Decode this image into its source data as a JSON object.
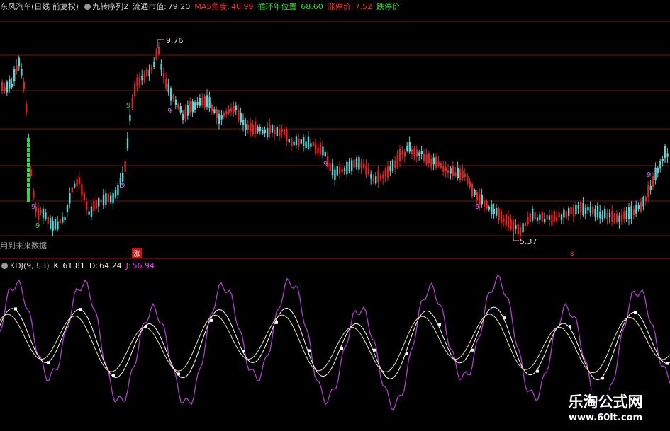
{
  "header": {
    "stock_title": "东风汽车(日线 前复权)",
    "indicator_name": "九转序列2",
    "float_cap_label": "流通市值:",
    "float_cap_value": "79.20",
    "ma5_angle_label": "MA5角度:",
    "ma5_angle_value": "40.99",
    "cycle_pos_label": "循环年位置:",
    "cycle_pos_value": "68.60",
    "limit_up_label": "涨停价:",
    "limit_up_value": "7.52",
    "limit_down_label": "跌停价"
  },
  "price_pane": {
    "high_label": "9.76",
    "low_label": "5.37",
    "future_data_note": "用到未来数据",
    "rise_marker": "涨"
  },
  "kdj_pane": {
    "name": "KDJ(9,3,3)",
    "k_label": "K:",
    "k_value": "61.81",
    "d_label": "D:",
    "d_value": "64.24",
    "j_label": "J:",
    "j_value": "56.94"
  },
  "watermark": {
    "site_name": "乐淘公式网",
    "url": "www.60lt.com"
  },
  "colors": {
    "background": "#000000",
    "up": "#e02424",
    "down": "#5fd3d3",
    "grid": "#7a1212",
    "nine_green": "#33dd33",
    "nine_magenta": "#cc66ff",
    "k_line": "#ffffff",
    "d_line": "#e8e8a0",
    "j_line": "#b040c8",
    "label_gray": "#d0d0d0",
    "label_red": "#ff3030",
    "label_green": "#33dd33",
    "label_magenta": "#ff33ff"
  },
  "chart_data": {
    "type": "candlestick",
    "price_range": [
      5.0,
      10.2
    ],
    "annotated_high": 9.76,
    "annotated_low": 5.37,
    "indicator": {
      "type": "line",
      "name": "KDJ(9,3,3)",
      "series": [
        {
          "name": "K",
          "last": 61.81
        },
        {
          "name": "D",
          "last": 64.24
        },
        {
          "name": "J",
          "last": 56.94
        }
      ]
    }
  }
}
